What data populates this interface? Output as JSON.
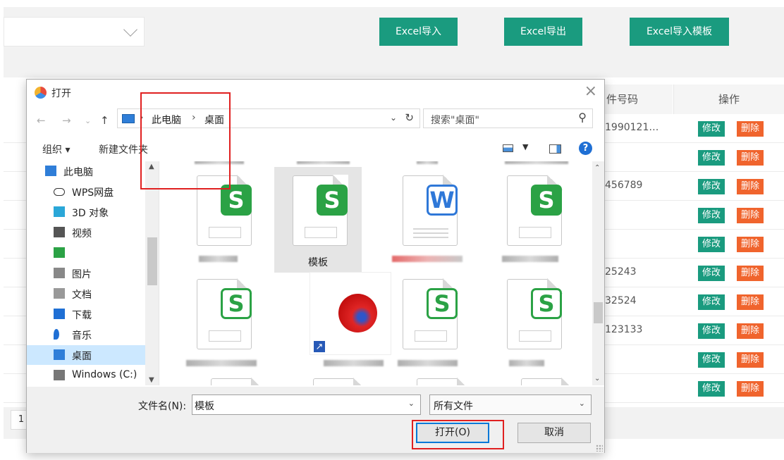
{
  "app": {
    "buttons": {
      "excel_import": "Excel导入",
      "excel_export": "Excel导出",
      "excel_template": "Excel导入模板"
    },
    "table": {
      "headers": {
        "id_number": "件号码",
        "actions": "操作"
      },
      "rows": [
        {
          "id": "1990121…",
          "edit": "修改",
          "del": "删除"
        },
        {
          "id": "",
          "edit": "修改",
          "del": "删除"
        },
        {
          "id": "456789",
          "edit": "修改",
          "del": "删除"
        },
        {
          "id": "",
          "edit": "修改",
          "del": "删除"
        },
        {
          "id": "",
          "edit": "修改",
          "del": "删除"
        },
        {
          "id": "25243",
          "edit": "修改",
          "del": "删除"
        },
        {
          "id": "32524",
          "edit": "修改",
          "del": "删除"
        },
        {
          "id": "123133",
          "edit": "修改",
          "del": "删除"
        },
        {
          "id": "",
          "edit": "修改",
          "del": "删除"
        },
        {
          "id": "",
          "edit": "修改",
          "del": "删除"
        }
      ]
    },
    "pager": {
      "page": "1"
    }
  },
  "dialog": {
    "title": "打开",
    "close": "×",
    "breadcrumb": {
      "pc": "此电脑",
      "desktop": "桌面",
      "sep": "›"
    },
    "search_placeholder": "搜索\"桌面\"",
    "toolbar": {
      "organize": "组织 ▾",
      "new_folder": "新建文件夹",
      "help": "?"
    },
    "sidebar": [
      {
        "label": "此电脑",
        "icon": "computer-icon"
      },
      {
        "label": "WPS网盘",
        "icon": "cloud-icon"
      },
      {
        "label": "3D 对象",
        "icon": "cube-icon"
      },
      {
        "label": "视频",
        "icon": "video-icon"
      },
      {
        "label": "",
        "icon": "green-app-icon"
      },
      {
        "label": "图片",
        "icon": "picture-icon"
      },
      {
        "label": "文档",
        "icon": "document-icon"
      },
      {
        "label": "下载",
        "icon": "download-icon"
      },
      {
        "label": "音乐",
        "icon": "music-icon"
      },
      {
        "label": "桌面",
        "icon": "desktop-icon"
      },
      {
        "label": "Windows (C:)",
        "icon": "drive-icon"
      }
    ],
    "files": {
      "selected_name": "模板"
    },
    "filename_label": "文件名(N):",
    "filename_value": "模板",
    "filetype_value": "所有文件",
    "open_button": "打开(O)",
    "cancel_button": "取消"
  },
  "colors": {
    "accent": "#1a9b7f",
    "danger": "#f0642d",
    "highlight": "#e02020",
    "selection": "#cce8ff"
  }
}
